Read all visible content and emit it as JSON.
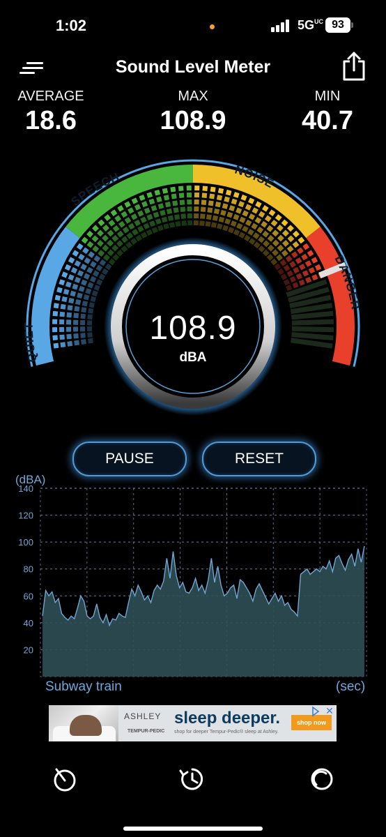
{
  "status_bar": {
    "time": "1:02",
    "network": "5G",
    "network_suffix": "UC",
    "battery": "93"
  },
  "header": {
    "title": "Sound Level Meter",
    "menu_icon": "menu-lines-icon",
    "share_icon": "share-icon"
  },
  "stats": [
    {
      "label": "AVERAGE",
      "value": "18.6"
    },
    {
      "label": "MAX",
      "value": "108.9"
    },
    {
      "label": "MIN",
      "value": "40.7"
    }
  ],
  "gauge": {
    "reading": "108.9",
    "unit": "dBA",
    "zones": [
      {
        "label": "QUIET",
        "color": "#5aa7e6"
      },
      {
        "label": "SPEECH",
        "color": "#49b63d"
      },
      {
        "label": "NOISE",
        "color": "#f0c02a"
      },
      {
        "label": "DANGER",
        "color": "#e8402a"
      }
    ]
  },
  "controls": {
    "pause_label": "PAUSE",
    "reset_label": "RESET"
  },
  "chart": {
    "unit_label": "(dBA)",
    "caption": "Subway train",
    "x_unit": "(sec)",
    "accent": "#6fa8d8"
  },
  "chart_data": {
    "type": "area",
    "ylabel": "(dBA)",
    "xlabel": "(sec)",
    "ylim": [
      0,
      140
    ],
    "yticks": [
      20,
      40,
      60,
      80,
      100,
      120,
      140
    ],
    "grid": true,
    "series": [
      {
        "values": [
          45,
          64,
          60,
          63,
          55,
          58,
          47,
          44,
          42,
          45,
          43,
          51,
          60,
          56,
          45,
          43,
          45,
          54,
          44,
          40,
          46,
          38,
          43,
          42,
          47,
          45,
          44,
          55,
          65,
          60,
          68,
          63,
          57,
          60,
          55,
          64,
          68,
          65,
          71,
          88,
          73,
          93,
          75,
          66,
          70,
          63,
          62,
          66,
          73,
          64,
          68,
          62,
          72,
          88,
          70,
          82,
          68,
          60,
          62,
          66,
          68,
          58,
          72,
          70,
          66,
          62,
          56,
          65,
          69,
          64,
          59,
          54,
          58,
          62,
          56,
          60,
          53,
          55,
          50,
          48,
          45,
          76,
          78,
          80,
          76,
          78,
          80,
          78,
          82,
          80,
          86,
          78,
          88,
          90,
          84,
          79,
          87,
          91,
          82,
          95,
          85,
          97
        ]
      }
    ]
  },
  "ad": {
    "brand": "ASHLEY",
    "brand2": "TEMPUR-PEDIC",
    "headline": "sleep deeper.",
    "sub": "shop for deeper Tempur-Pedic® sleep at Ashley.",
    "cta": "shop now"
  },
  "nav": {
    "items": [
      "gauge-icon",
      "history-icon",
      "settings-icon"
    ]
  }
}
